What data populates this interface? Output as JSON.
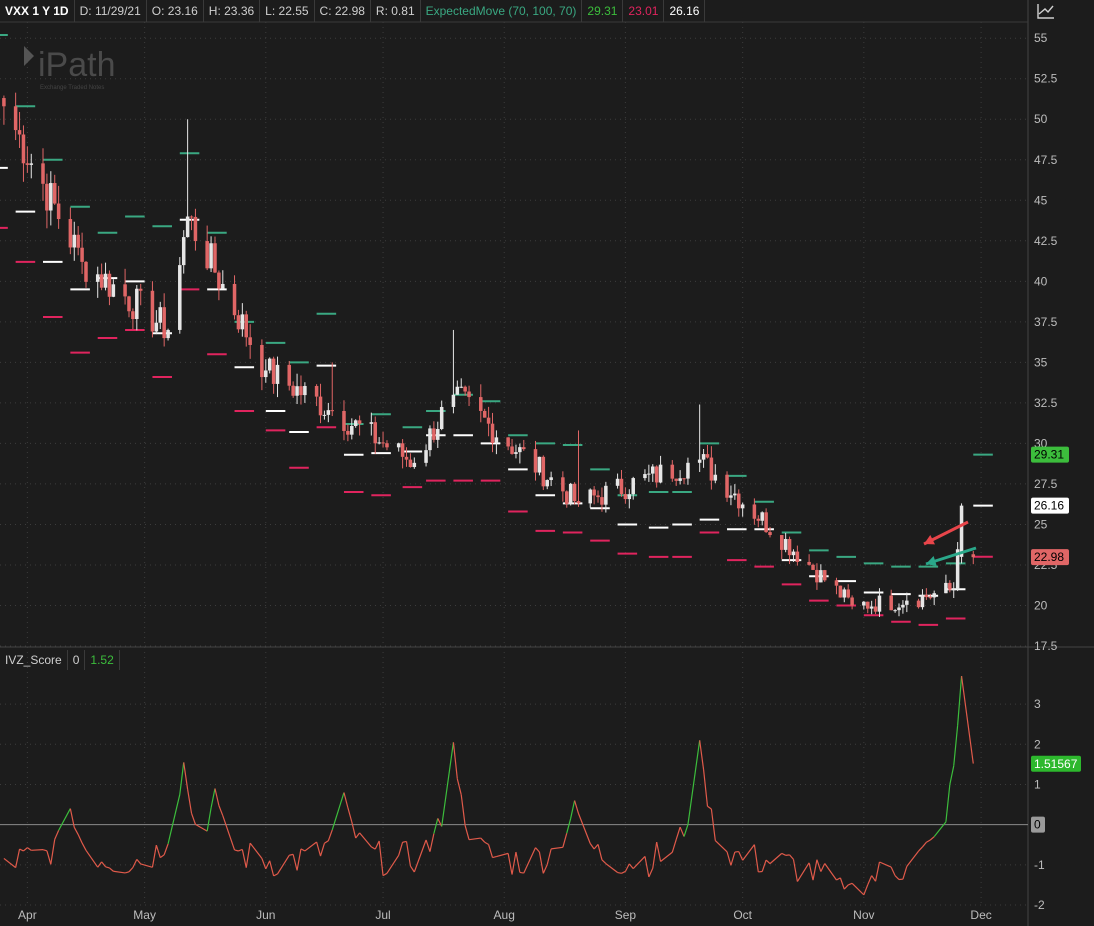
{
  "header": {
    "symbol": "VXX 1 Y 1D",
    "date": "D: 11/29/21",
    "open": "O: 23.16",
    "high": "H: 23.36",
    "low": "L: 22.55",
    "close": "C: 22.98",
    "range": "R: 0.81",
    "study": "ExpectedMove (70, 100, 70)",
    "study_upper": "29.31",
    "study_lower": "23.01",
    "study_price": "26.16"
  },
  "subpanel": {
    "name": "IVZ_Score",
    "zero": "0",
    "value": "1.52"
  },
  "logo": {
    "text": "iPath",
    "tagline": "Exchange Traded Notes"
  },
  "colors": {
    "background": "#1c1c1c",
    "grid": "#3c3c3c",
    "up": "#e6e6e6",
    "down": "#e06666",
    "em_upper": "#3aa882",
    "em_lower": "#e0245e",
    "em_mid": "#ffffff",
    "osc_up": "#3cbd3c",
    "osc_down": "#e05a4a",
    "zero_line": "#8a8a8a"
  },
  "chart_data": [
    {
      "type": "candlestick",
      "ylim": [
        17.5,
        56
      ],
      "yticks": [
        "55",
        "52.5",
        "50",
        "47.5",
        "45",
        "42.5",
        "40",
        "37.5",
        "35",
        "32.5",
        "30",
        "27.5",
        "25",
        "22.5",
        "20",
        "17.5"
      ],
      "months": [
        "Apr",
        "May",
        "Jun",
        "Jul",
        "Aug",
        "Sep",
        "Oct",
        "Nov",
        "Dec"
      ],
      "x_range": [
        "2021-03-25",
        "2021-12-13"
      ],
      "price_labels": [
        {
          "label": "29.31",
          "value": 29.31,
          "kind": "upper"
        },
        {
          "label": "26.16",
          "value": 26.16,
          "kind": "price"
        },
        {
          "label": "22.98",
          "value": 22.98,
          "kind": "last"
        }
      ],
      "key_points": [
        {
          "date": "2021-03-26",
          "close": 50.8
        },
        {
          "date": "2021-04-15",
          "close": 41.2
        },
        {
          "date": "2021-05-07",
          "close": 37.0
        },
        {
          "date": "2021-05-12",
          "high": 50.0,
          "close": 44.0
        },
        {
          "date": "2021-06-01",
          "close": 34.5
        },
        {
          "date": "2021-06-18",
          "high": 35.0,
          "close": 32.0
        },
        {
          "date": "2021-07-09",
          "close": 28.8
        },
        {
          "date": "2021-07-19",
          "high": 37.0,
          "close": 33.0
        },
        {
          "date": "2021-08-20",
          "high": 30.8,
          "close": 26.3
        },
        {
          "date": "2021-09-20",
          "high": 32.4,
          "close": 29.0
        },
        {
          "date": "2021-10-29",
          "close": 20.0
        },
        {
          "date": "2021-11-12",
          "close": 20.3
        },
        {
          "date": "2021-11-24",
          "close": 21.0
        },
        {
          "date": "2021-11-26",
          "open": 23.0,
          "high": 26.3,
          "close": 26.16
        },
        {
          "date": "2021-11-29",
          "open": 23.16,
          "high": 23.36,
          "low": 22.55,
          "close": 22.98
        }
      ],
      "expected_move_weekly": [
        {
          "week": "2021-03-22",
          "upper": 55.2,
          "mid": 47.0,
          "lower": 43.3
        },
        {
          "week": "2021-03-29",
          "upper": 50.8,
          "mid": 44.3,
          "lower": 41.2
        },
        {
          "week": "2021-04-05",
          "upper": 47.5,
          "mid": 41.2,
          "lower": 37.8
        },
        {
          "week": "2021-04-12",
          "upper": 44.6,
          "mid": 39.5,
          "lower": 35.6
        },
        {
          "week": "2021-04-19",
          "upper": 43.0,
          "mid": 40.2,
          "lower": 36.5
        },
        {
          "week": "2021-04-26",
          "upper": 44.0,
          "mid": 40.0,
          "lower": 37.0
        },
        {
          "week": "2021-05-03",
          "upper": 43.4,
          "mid": 36.8,
          "lower": 34.1
        },
        {
          "week": "2021-05-10",
          "upper": 47.9,
          "mid": 43.8,
          "lower": 39.5
        },
        {
          "week": "2021-05-17",
          "upper": 43.0,
          "mid": 39.5,
          "lower": 35.5
        },
        {
          "week": "2021-05-24",
          "upper": 37.5,
          "mid": 34.7,
          "lower": 32.0
        },
        {
          "week": "2021-06-01",
          "upper": 36.2,
          "mid": 32.0,
          "lower": 30.8
        },
        {
          "week": "2021-06-07",
          "upper": 35.0,
          "mid": 30.7,
          "lower": 28.5
        },
        {
          "week": "2021-06-14",
          "upper": 38.0,
          "mid": 34.8,
          "lower": 31.0
        },
        {
          "week": "2021-06-21",
          "upper": 31.2,
          "mid": 29.3,
          "lower": 27.0
        },
        {
          "week": "2021-06-28",
          "upper": 31.8,
          "mid": 29.4,
          "lower": 26.8
        },
        {
          "week": "2021-07-06",
          "upper": 31.0,
          "mid": 29.5,
          "lower": 27.3
        },
        {
          "week": "2021-07-12",
          "upper": 32.0,
          "mid": 30.5,
          "lower": 27.7
        },
        {
          "week": "2021-07-19",
          "upper": 33.0,
          "mid": 30.5,
          "lower": 27.7
        },
        {
          "week": "2021-07-26",
          "upper": 32.6,
          "mid": 30.0,
          "lower": 27.7
        },
        {
          "week": "2021-08-02",
          "upper": 30.5,
          "mid": 28.4,
          "lower": 25.8
        },
        {
          "week": "2021-08-09",
          "upper": 30.0,
          "mid": 26.8,
          "lower": 24.6
        },
        {
          "week": "2021-08-16",
          "upper": 29.9,
          "mid": 26.3,
          "lower": 24.5
        },
        {
          "week": "2021-08-23",
          "upper": 28.4,
          "mid": 26.0,
          "lower": 24.0
        },
        {
          "week": "2021-08-30",
          "upper": 26.8,
          "mid": 25.0,
          "lower": 23.2
        },
        {
          "week": "2021-09-07",
          "upper": 27.0,
          "mid": 24.8,
          "lower": 23.0
        },
        {
          "week": "2021-09-13",
          "upper": 27.0,
          "mid": 25.0,
          "lower": 23.0
        },
        {
          "week": "2021-09-20",
          "upper": 30.0,
          "mid": 25.3,
          "lower": 24.5
        },
        {
          "week": "2021-09-27",
          "upper": 28.0,
          "mid": 24.7,
          "lower": 22.8
        },
        {
          "week": "2021-10-04",
          "upper": 26.4,
          "mid": 24.7,
          "lower": 22.4
        },
        {
          "week": "2021-10-11",
          "upper": 24.5,
          "mid": 22.8,
          "lower": 21.3
        },
        {
          "week": "2021-10-18",
          "upper": 23.4,
          "mid": 21.8,
          "lower": 20.3
        },
        {
          "week": "2021-10-25",
          "upper": 23.0,
          "mid": 21.5,
          "lower": 20.0
        },
        {
          "week": "2021-11-01",
          "upper": 22.6,
          "mid": 20.8,
          "lower": 19.4
        },
        {
          "week": "2021-11-08",
          "upper": 22.4,
          "mid": 20.7,
          "lower": 19.0
        },
        {
          "week": "2021-11-15",
          "upper": 22.4,
          "mid": 20.6,
          "lower": 18.8
        },
        {
          "week": "2021-11-22",
          "upper": 22.6,
          "mid": 21.0,
          "lower": 19.2
        },
        {
          "week": "2021-11-29",
          "upper": 29.31,
          "mid": 26.16,
          "lower": 23.01
        }
      ]
    },
    {
      "type": "line",
      "name": "IVZ_Score",
      "ylim": [
        -2,
        3.8
      ],
      "yticks": [
        "3",
        "2",
        "1",
        "0",
        "-1",
        "-2"
      ],
      "last_label": "1.51567",
      "zero_label": "0",
      "key_points": [
        {
          "date": "2021-04-12",
          "value": 0.4
        },
        {
          "date": "2021-05-11",
          "value": 1.55
        },
        {
          "date": "2021-05-19",
          "value": 0.9
        },
        {
          "date": "2021-06-21",
          "value": 0.8
        },
        {
          "date": "2021-07-19",
          "value": 2.05
        },
        {
          "date": "2021-08-19",
          "value": 0.6
        },
        {
          "date": "2021-09-20",
          "value": 2.1
        },
        {
          "date": "2021-10-28",
          "value": -1.5
        },
        {
          "date": "2021-11-26",
          "value": 3.7
        },
        {
          "date": "2021-11-29",
          "value": 1.52
        }
      ]
    }
  ]
}
